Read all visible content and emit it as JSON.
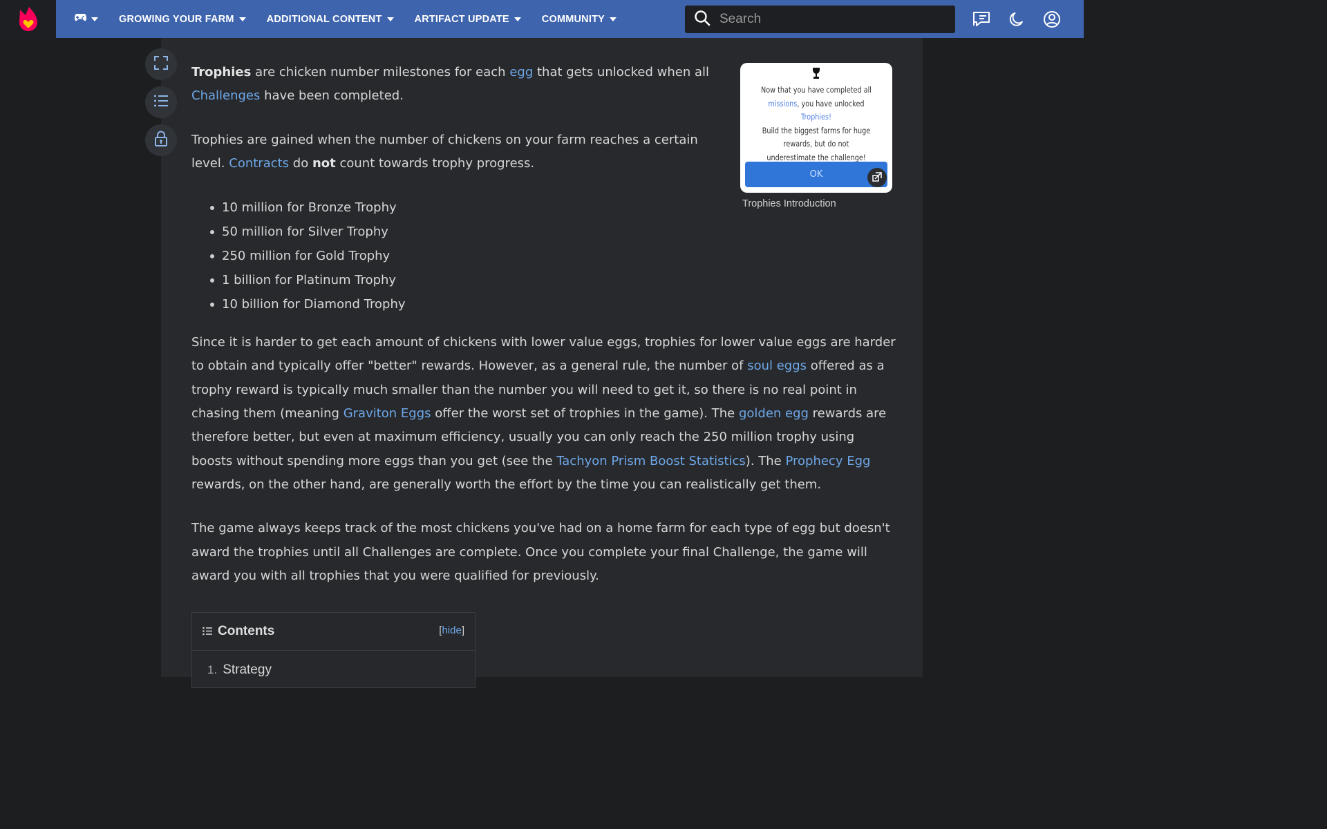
{
  "nav": {
    "items": [
      {
        "label": "GROWING YOUR FARM"
      },
      {
        "label": "ADDITIONAL CONTENT"
      },
      {
        "label": "ARTIFACT UPDATE"
      },
      {
        "label": "COMMUNITY"
      }
    ],
    "search_placeholder": "Search"
  },
  "colors": {
    "topbar": "#3e64ad",
    "link": "#6ea7e8",
    "panel": "#27292c",
    "background": "#1d1e20"
  },
  "icons": [
    "fandom-logo-icon",
    "gamepad-icon",
    "search-icon",
    "discussions-icon",
    "moon-icon",
    "user-icon",
    "fullscreen-icon",
    "list-icon",
    "lock-icon",
    "expand-icon",
    "toc-list-icon"
  ],
  "article": {
    "p1": {
      "bold": "Trophies",
      "t1": " are chicken number milestones for each ",
      "link1": "egg",
      "t2": " that gets unlocked when all ",
      "link2": "Challenges",
      "t3": " have been completed."
    },
    "p2": {
      "t1": "Trophies are gained when the number of chickens on your farm reaches a certain level. ",
      "link1": "Contracts",
      "t2": " do ",
      "bold": "not",
      "t3": " count towards trophy progress."
    },
    "trophies": [
      "10 million for Bronze Trophy",
      "50 million for Silver Trophy",
      "250 million for Gold Trophy",
      "1 billion for Platinum Trophy",
      "10 billion for Diamond Trophy"
    ],
    "p3": {
      "t1": "Since it is harder to get each amount of chickens with lower value eggs, trophies for lower value eggs are harder to obtain and typically offer \"better\" rewards. However, as a general rule, the number of ",
      "link1": "soul eggs",
      "t2": " offered as a trophy reward is typically much smaller than the number you will need to get it, so there is no real point in chasing them (meaning ",
      "link2": "Graviton Eggs",
      "t3": " offer the worst set of trophies in the game). The ",
      "link3": "golden egg",
      "t4": " rewards are therefore better, but even at maximum efficiency, usually you can only reach the 250 million trophy using boosts without spending more eggs than you get (see the ",
      "link4": "Tachyon Prism Boost Statistics",
      "t5": "). The ",
      "link5": "Prophecy Egg",
      "t6": " rewards, on the other hand, are generally worth the effort by the time you can realistically get them."
    },
    "p4": "The game always keeps track of the most chickens you've had on a home farm for each type of egg but doesn't award the trophies until all Challenges are complete. Once you complete your final Challenge, the game will award you with all trophies that you were qualified for previously."
  },
  "figure": {
    "img_line1": "Now that you have completed all",
    "img_link1": "missions",
    "img_line2": ", you have unlocked ",
    "img_link2": "Trophies!",
    "img_line3": "Build the biggest farms for huge rewards, but do not underestimate the challenge!",
    "img_button": "OK",
    "caption": "Trophies Introduction"
  },
  "toc": {
    "title": "Contents",
    "bracket_open": "[",
    "hide": "hide",
    "bracket_close": "]",
    "items": [
      {
        "num": "1.",
        "label": "Strategy"
      }
    ]
  }
}
